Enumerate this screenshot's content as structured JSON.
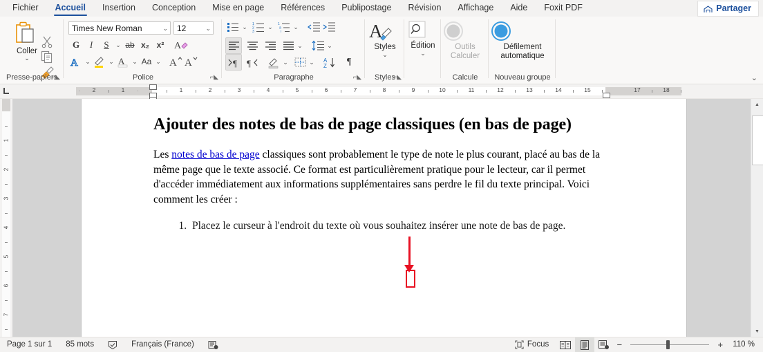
{
  "window": {
    "app": "Microsoft Word",
    "share_label": "Partager",
    "share_icon": "share-icon",
    "ribbon_collapse_icon": "chevron-down-icon"
  },
  "tabs": [
    {
      "label": "Fichier",
      "active": false
    },
    {
      "label": "Accueil",
      "active": true
    },
    {
      "label": "Insertion",
      "active": false
    },
    {
      "label": "Conception",
      "active": false
    },
    {
      "label": "Mise en page",
      "active": false
    },
    {
      "label": "Références",
      "active": false
    },
    {
      "label": "Publipostage",
      "active": false
    },
    {
      "label": "Révision",
      "active": false
    },
    {
      "label": "Affichage",
      "active": false
    },
    {
      "label": "Aide",
      "active": false
    },
    {
      "label": "Foxit PDF",
      "active": false
    }
  ],
  "ribbon": {
    "groups": [
      {
        "name": "clipboard",
        "label": "Presse-papiers"
      },
      {
        "name": "font",
        "label": "Police"
      },
      {
        "name": "paragraph",
        "label": "Paragraphe"
      },
      {
        "name": "styles",
        "label": "Styles"
      },
      {
        "name": "edition",
        "label": ""
      },
      {
        "name": "calcule",
        "label": "Calcule"
      },
      {
        "name": "nouveau_groupe",
        "label": "Nouveau groupe"
      }
    ],
    "clipboard": {
      "paste_label": "Coller",
      "paste_icon": "paste-clipboard-icon",
      "cut_icon": "scissors-icon",
      "copy_icon": "copy-icon",
      "format_painter_icon": "format-painter-icon",
      "dialog_launcher_icon": "dialog-launcher-icon"
    },
    "font": {
      "font_name": "Times New Roman",
      "font_size": "12",
      "bold_label": "G",
      "italic_label": "I",
      "underline_label": "S",
      "strikethrough_label": "ab",
      "subscript_label": "x₂",
      "superscript_label": "x²",
      "clear_format_icon": "clear-formatting-icon",
      "text_effects_label": "A",
      "highlight_label": "pen-highlight-icon",
      "font_color_label": "A",
      "change_case_label": "Aa",
      "grow_font_label": "A",
      "shrink_font_label": "A",
      "dialog_launcher_icon": "dialog-launcher-icon"
    },
    "paragraph": {
      "bullets_icon": "bullet-list-icon",
      "numbering_icon": "numbered-list-icon",
      "multilevel_icon": "multilevel-list-icon",
      "decrease_indent_icon": "decrease-indent-icon",
      "increase_indent_icon": "increase-indent-icon",
      "align_left_icon": "align-left-icon",
      "align_center_icon": "align-center-icon",
      "align_right_icon": "align-right-icon",
      "justify_icon": "justify-icon",
      "line_spacing_icon": "line-spacing-icon",
      "ltr_icon": "text-direction-ltr-icon",
      "rtl_icon": "text-direction-rtl-icon",
      "shading_icon": "shading-icon",
      "borders_icon": "borders-icon",
      "sort_icon": "sort-az-icon",
      "show_marks_label": "¶",
      "dialog_launcher_icon": "dialog-launcher-icon"
    },
    "styles": {
      "button_label": "Styles",
      "icon": "styles-brush-icon",
      "dialog_launcher_icon": "dialog-launcher-icon"
    },
    "edition": {
      "button_label": "Édition",
      "icon": "magnifier-icon"
    },
    "calcule": {
      "button_line1": "Outils",
      "button_line2": "Calculer",
      "icon": "grey-circle-icon",
      "disabled": true
    },
    "nouveau_groupe": {
      "button_line1": "Défilement",
      "button_line2": "automatique",
      "icon": "blue-circle-icon"
    }
  },
  "ruler": {
    "horizontal_numbers": [
      "2",
      "1",
      "1",
      "2",
      "3",
      "4",
      "5",
      "6",
      "7",
      "8",
      "9",
      "10",
      "11",
      "12",
      "13",
      "14",
      "15",
      "17",
      "18"
    ],
    "vertical_numbers": [
      "1",
      "2",
      "3",
      "4",
      "5",
      "6",
      "7"
    ],
    "tab_stop_icon": "left-tab-stop-icon",
    "first_line_indent_icon": "first-line-indent-marker",
    "right_indent_icon": "right-indent-marker"
  },
  "document": {
    "heading": "Ajouter des notes de bas de page classiques (en bas de page)",
    "paragraph_prefix": "Les ",
    "paragraph_link": "notes de bas de page",
    "paragraph_rest": " classiques sont probablement le type de note le plus courant, placé au bas de la même page que le texte associé. Ce format est particulièrement pratique pour le lecteur, car il permet d'accéder immédiatement aux informations supplémentaires sans perdre le fil du texte principal. Voici comment les créer :",
    "list_items": [
      "Placez le curseur à l'endroit du texte où vous souhaitez insérer une note de bas de page."
    ],
    "annotation": {
      "type": "red-arrow-pointing-to-cursor",
      "color": "#e81123"
    }
  },
  "status_bar": {
    "page_info": "Page 1 sur 1",
    "word_count": "85 mots",
    "proofing_icon": "proofing-check-icon",
    "language": "Français (France)",
    "accessibility_icon": "accessibility-icon",
    "focus_label": "Focus",
    "focus_icon": "focus-icon",
    "read_mode_icon": "read-mode-icon",
    "print_layout_icon": "print-layout-icon",
    "web_layout_icon": "web-layout-icon",
    "zoom_out_label": "−",
    "zoom_in_label": "+",
    "zoom_level": "110 %"
  },
  "scrollbar": {
    "up_icon": "scroll-up-arrow",
    "down_icon": "scroll-down-arrow"
  },
  "colors": {
    "accent": "#1b4f9c",
    "ribbon_bg": "#f9f8f7",
    "annotation_red": "#e81123",
    "link_blue": "#0000d0"
  }
}
